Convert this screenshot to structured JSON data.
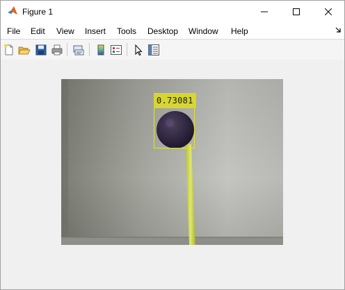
{
  "window": {
    "title": "Figure 1"
  },
  "menubar": {
    "items": [
      {
        "label": "File"
      },
      {
        "label": "Edit"
      },
      {
        "label": "View"
      },
      {
        "label": "Insert"
      },
      {
        "label": "Tools"
      },
      {
        "label": "Desktop"
      },
      {
        "label": "Window"
      },
      {
        "label": "Help"
      }
    ]
  },
  "toolbar": {
    "buttons": [
      {
        "icon": "new-figure-icon"
      },
      {
        "icon": "open-file-icon"
      },
      {
        "icon": "save-icon"
      },
      {
        "icon": "print-icon"
      },
      {
        "icon": "link-plot-icon"
      },
      {
        "icon": "insert-colorbar-icon"
      },
      {
        "icon": "insert-legend-icon"
      },
      {
        "icon": "edit-plot-pointer-icon"
      },
      {
        "icon": "open-property-inspector-icon"
      }
    ]
  },
  "figure": {
    "detection": {
      "score_label": "0.73081",
      "box_color": "#e3e32a",
      "label_background": "#d6d631"
    }
  },
  "colors": {
    "window_bg": "#f0f0f0",
    "titlebar_bg": "#ffffff",
    "matlab_accent": "#c94a12"
  }
}
